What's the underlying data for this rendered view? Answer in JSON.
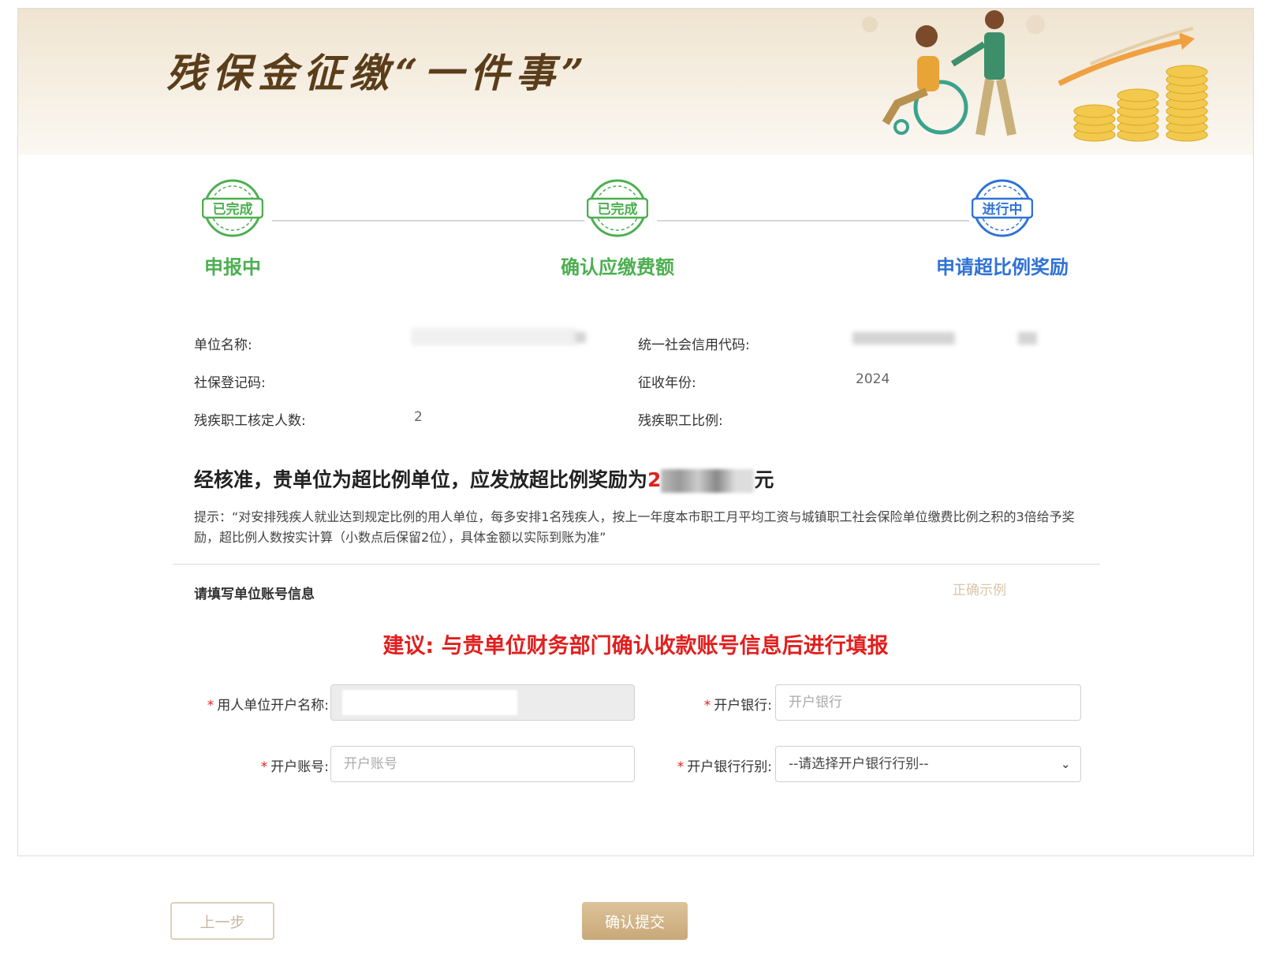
{
  "banner": {
    "title": "残保金征缴“一件事”"
  },
  "steps": [
    {
      "badge": "已完成",
      "label": "申报中",
      "status": "done"
    },
    {
      "badge": "已完成",
      "label": "确认应缴费额",
      "status": "done"
    },
    {
      "badge": "进行中",
      "label": "申请超比例奖励",
      "status": "active"
    }
  ],
  "colors": {
    "done": "#4caf50",
    "active": "#2f72d6",
    "required": "#e02020",
    "accent": "#c9a878"
  },
  "info": {
    "unit_name_label": "单位名称:",
    "credit_code_label": "统一社会信用代码:",
    "social_reg_label": "社保登记码:",
    "year_label": "征收年份:",
    "year_value": "2024",
    "approved_count_label": "残疾职工核定人数:",
    "approved_count_value": "2",
    "ratio_label": "残疾职工比例:"
  },
  "summary": {
    "text": "经核准，贵单位为超比例单位，应发放超比例奖励为",
    "amount_first_char": "2",
    "unit": "元"
  },
  "hint": "提示：“对安排残疾人就业达到规定比例的用人单位，每多安排1名残疾人，按上一年度本市职工月平均工资与城镇职工社会保险单位缴费比例之积的3倍给予奖励，超比例人数按实计算（小数点后保留2位），具体金额以实际到账为准”",
  "account": {
    "section_title": "请填写单位账号信息",
    "example_link": "正确示例",
    "suggestion": "建议: 与贵单位财务部门确认收款账号信息后进行填报",
    "required_mark": "*",
    "account_name_label": "用人单位开户名称:",
    "bank_label": "开户银行:",
    "bank_placeholder": "开户银行",
    "account_no_label": "开户账号:",
    "account_no_placeholder": "开户账号",
    "bank_type_label": "开户银行行别:",
    "bank_type_selected": "--请选择开户银行行别--"
  },
  "buttons": {
    "prev": "上一步",
    "submit": "确认提交"
  }
}
